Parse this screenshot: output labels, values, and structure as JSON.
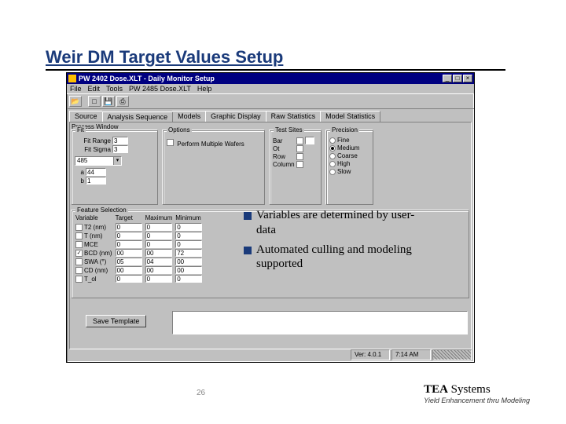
{
  "slide": {
    "title": "Weir DM Target Values Setup",
    "page_number": "26"
  },
  "window": {
    "title": "PW 2402 Dose.XLT - Daily Monitor Setup",
    "menus": [
      "File",
      "Edit",
      "Tools",
      "PW 2485 Dose.XLT",
      "Help"
    ],
    "tabs": [
      "Source",
      "Analysis Sequence",
      "Models",
      "Graphic Display",
      "Raw Statistics",
      "Model Statistics"
    ],
    "active_tab": 1,
    "process_window_label": "Process Window",
    "fit_group_label": "Fit",
    "fit_range_label": "Fit Range",
    "fit_sigma_label": "Fit Sigma",
    "fit_range_value": "3",
    "fit_sigma_value": "3",
    "dropdown_value": "485",
    "sub_label_a": "a",
    "sub_label_b": "b",
    "sub_val_a": "44",
    "sub_val_b": "1",
    "options_label": "Options",
    "perform_multi_label": "Perform Multiple Wafers",
    "test_sites_label": "Test Sites",
    "test_sites": [
      "Bar",
      "Ot",
      "Row",
      "Column"
    ],
    "precision_label": "Precision",
    "precisions": [
      "Fine",
      "Medium",
      "Coarse",
      "High",
      "Slow"
    ],
    "precision_selected": "Medium",
    "feature_group_label": "Feature Selection",
    "feature_headers": [
      "Variable",
      "Target",
      "Maximum",
      "Minimum"
    ],
    "features": [
      {
        "name": "T2 (nm)",
        "on": false,
        "t": "0",
        "max": "0",
        "min": "0"
      },
      {
        "name": "T (nm)",
        "on": false,
        "t": "0",
        "max": "0",
        "min": "0"
      },
      {
        "name": "MCE",
        "on": false,
        "t": "0",
        "max": "0",
        "min": "0"
      },
      {
        "name": "BCD (nm)",
        "on": true,
        "t": "00",
        "max": "00",
        "min": "72"
      },
      {
        "name": "SWA (°)",
        "on": false,
        "t": "05",
        "max": "04",
        "min": "00"
      },
      {
        "name": "CD (nm)",
        "on": false,
        "t": "00",
        "max": "00",
        "min": "00"
      },
      {
        "name": "T_ol",
        "on": false,
        "t": "0",
        "max": "0",
        "min": "0"
      }
    ],
    "save_template_label": "Save Template",
    "status_version": "Ver: 4.0.1",
    "status_time": "7:14 AM"
  },
  "bullets": {
    "b1": "Variables are determined by user-data",
    "b2": "Automated culling and modeling supported"
  },
  "footer": {
    "brand_a": "TEA",
    "brand_b": " Systems",
    "tagline": "Yield Enhancement thru Modeling"
  }
}
